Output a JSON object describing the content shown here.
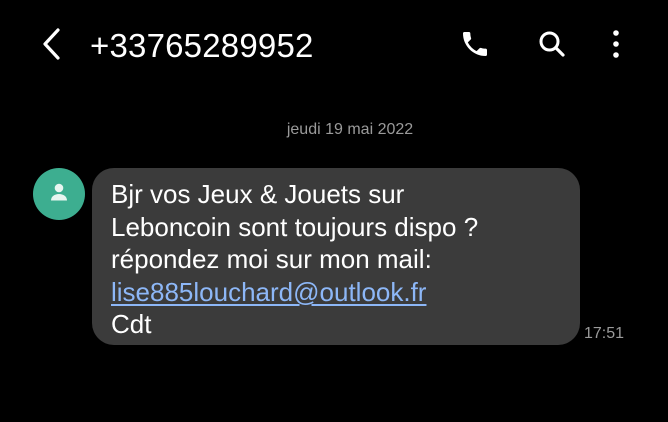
{
  "header": {
    "contact": "+33765289952",
    "icons": {
      "back": "back-arrow-icon",
      "call": "phone-icon",
      "search": "search-icon",
      "more": "more-vertical-icon"
    }
  },
  "conversation": {
    "date_separator": "jeudi 19 mai 2022",
    "messages": [
      {
        "avatar_icon": "person-icon",
        "lines": [
          "Bjr vos Jeux & Jouets sur",
          "Leboncoin sont toujours dispo ?",
          "répondez moi sur mon mail:"
        ],
        "link": "lise885louchard@outlook.fr",
        "closing": "Cdt",
        "time": "17:51"
      }
    ]
  },
  "colors": {
    "background": "#000000",
    "bubble": "#3b3b3b",
    "avatar": "#3dae90",
    "link": "#8db7f7",
    "muted_text": "#9a9a9a"
  }
}
